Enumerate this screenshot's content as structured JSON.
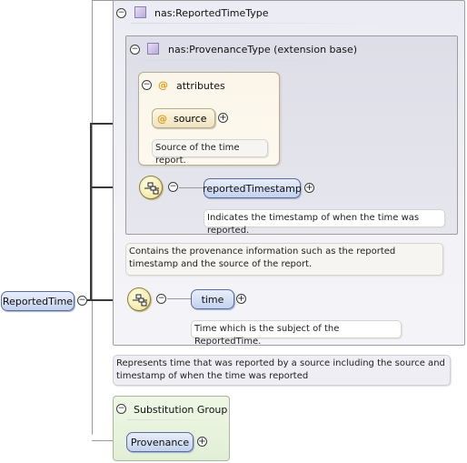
{
  "root_element": {
    "name": "ReportedTime"
  },
  "complex_type": {
    "title": "nas:ReportedTimeType",
    "annotation": "Represents time that was reported by a source including the source and timestamp of when the time was reported"
  },
  "extension": {
    "title": "nas:ProvenanceType (extension base)",
    "annotation": "Contains the provenance information such as the reported timestamp and the source of the report.",
    "attributes": {
      "title": "attributes",
      "items": [
        {
          "name": "source",
          "annotation": "Source of the time report."
        }
      ]
    },
    "sequence": [
      {
        "name": "reportedTimestamp",
        "annotation": "Indicates the timestamp of when the time was reported."
      }
    ]
  },
  "sequence": [
    {
      "name": "time",
      "annotation": "Time which is the subject of the ReportedTime."
    }
  ],
  "substitution_group": {
    "title": "Substitution Group",
    "members": [
      {
        "name": "Provenance"
      }
    ]
  },
  "icons": {
    "collapse": "minus-circle-icon",
    "expand": "plus-circle-icon",
    "type": "complex-type-square-icon",
    "attribute": "at-sign-icon",
    "sequence": "sequence-compositor-icon"
  },
  "colors": {
    "element_fill": "#c4d2ee",
    "element_border": "#5a6da0",
    "attribute_fill": "#efe3bf",
    "attribute_symbol": "#e39a12",
    "sequence_fill": "#efe29a",
    "substitution_fill": "#e8f3dc"
  }
}
